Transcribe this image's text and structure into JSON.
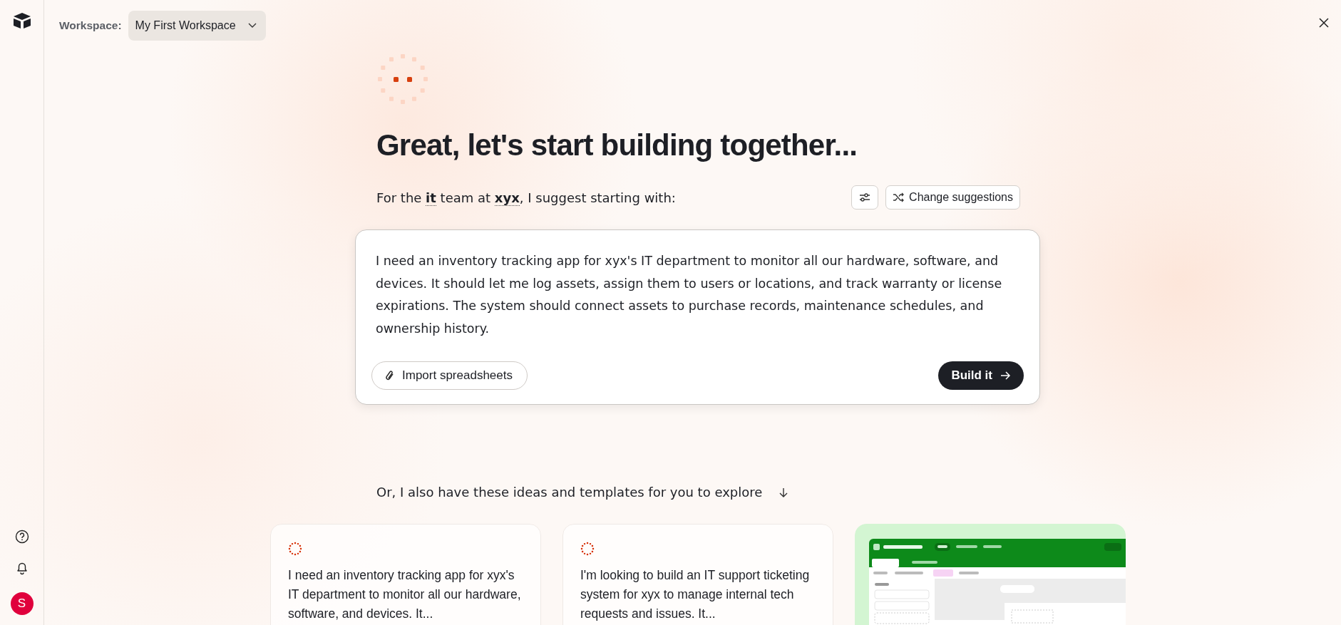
{
  "sidebar": {
    "avatar": "S"
  },
  "topbar": {
    "label": "Workspace:",
    "workspace": "My First Workspace"
  },
  "heading": "Great, let's start building together...",
  "intro": "For the **it** team at **xyx**, I suggest starting with:",
  "change_suggestions": "Change suggestions",
  "prompt": {
    "text": "I need an inventory tracking app for xyx's IT department to monitor all our hardware, software, and devices. It should let me log assets, assign them to users or locations, and track warranty or license expirations. The system should connect assets to purchase records, maintenance schedules, and ownership history.",
    "import_button": "Import spreadsheets",
    "build_button": "Build it"
  },
  "ideas": {
    "heading": "Or, I also have these ideas and templates for you to explore",
    "cards": [
      {
        "kind": "idea",
        "text": "I need an inventory tracking app for xyx's IT department to monitor all our hardware, software, and devices. It..."
      },
      {
        "kind": "idea",
        "text": "I'm looking to build an IT support ticketing system for xyx to manage internal tech requests and issues. It..."
      },
      {
        "kind": "template"
      }
    ]
  }
}
